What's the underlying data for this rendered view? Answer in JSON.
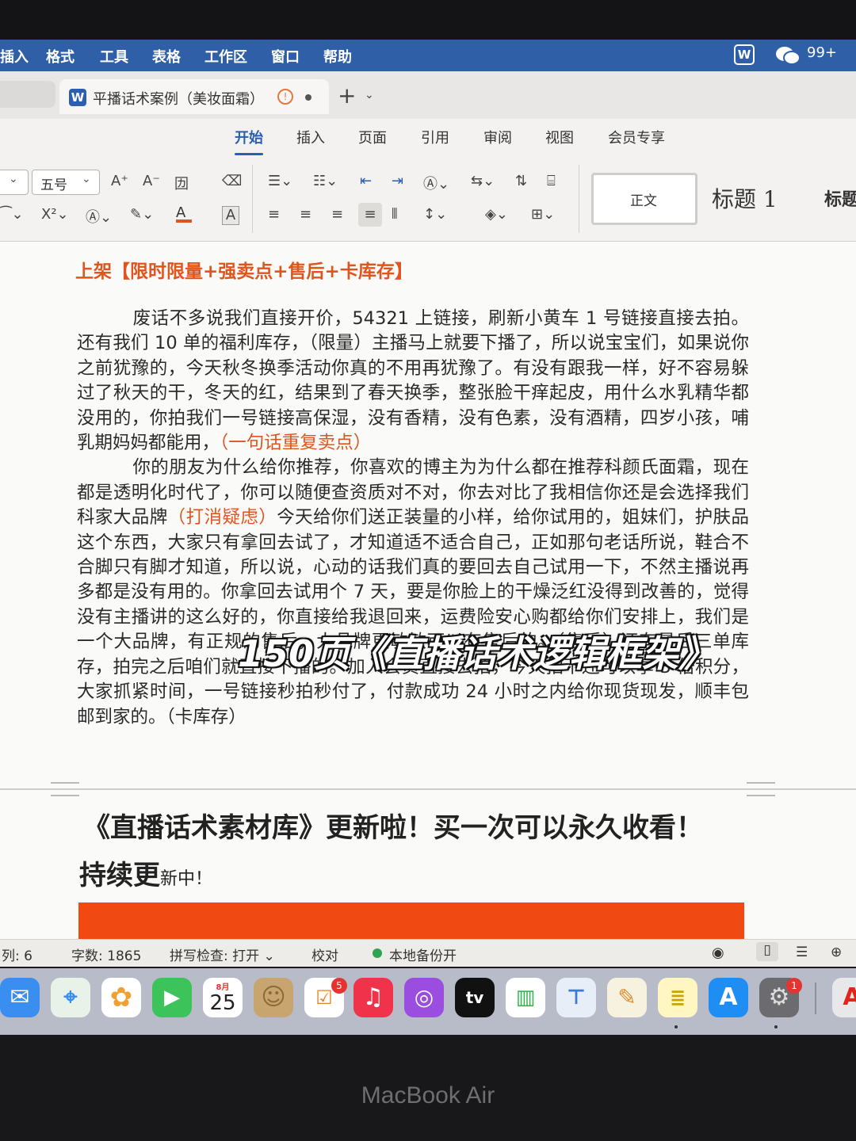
{
  "menubar": {
    "items": [
      "插入",
      "格式",
      "工具",
      "表格",
      "工作区",
      "窗口",
      "帮助"
    ],
    "wechat_badge": "99+"
  },
  "tabbar": {
    "doc_tab_title": "平播话术案例（美妆面霜）"
  },
  "ribbon": {
    "tabs": [
      "开始",
      "插入",
      "页面",
      "引用",
      "审阅",
      "视图",
      "会员专享"
    ],
    "active_tab": "开始"
  },
  "toolbar": {
    "font_size": "五号",
    "style_normal": "正文",
    "style_h1": "标题 1",
    "style_h2": "标题"
  },
  "document": {
    "heading": "上架【限时限量+强卖点+售后+卡库存】",
    "p1_a": "废话不多说我们直接开价，54321 上链接，刷新小黄车 1 号链接直接去拍。还有我们 10 单的福利库存，（限量）主播马上就要下播了，所以说宝宝们，如果说你之前犹豫的，今天秋冬换季活动你真的不用再犹豫了。有没有跟我一样，好不容易躲过了秋天的干，冬天的红，结果到了春天换季，整张脸干痒起皮，用什么水乳精华都没用的，你拍我们一号链接高保湿，没有香精，没有色素，没有酒精，四岁小孩，哺乳期妈妈都能用，",
    "p1_hl": "（一句话重复卖点）",
    "p2_a": "你的朋友为什么给你推荐，你喜欢的博主为为什么都在推荐科颜氏面霜，现在都是透明化时代了，你可以随便查资质对不对，你去对比了我相信你还是会选择我们科家大品牌",
    "p2_hl": "（打消疑虑）",
    "p2_b": "今天给你们送正装量的小样，给你试用的，姐妹们，护肤品这个东西，大家只有拿回去试了，才知道适不适合自己，正如那句老话所说，鞋合不合脚只有脚才知道，所以说，心动的话我们真的要回去自己试用一下，不然主播说再多都是没有用的。你拿回去试用个 7 天，要是你脸上的干燥泛红没得到改善的，觉得没有主播讲的这么好的，你直接给我退回来，运费险安心购都给你们安排上，我们是一个大品牌，有正规的售后，大品牌更敏敏可以有售后的。（售后）还有最后三单库存，拍完之后咱们就直接下播的。加入会员直接去拍，今天拍下还可以享 3 倍积分，大家抓紧时间，一号链接秒拍秒付了，付款成功 24 小时之内给你现货现发，顺丰包邮到家的。（卡库存）",
    "overlay_title": "150页《直播话术逻辑框架》",
    "library_title": "《直播话术素材库》更新啦！买一次可以永久收看！",
    "update_big": "持续更",
    "update_small": "新中！"
  },
  "statusbar": {
    "col": "列: 6",
    "word_count": "字数: 1865",
    "spellcheck": "拼写检查: 打开",
    "proofread": "校对",
    "backup": "本地备份开"
  },
  "dock": {
    "calendar_month": "8月",
    "calendar_day": "25",
    "reminders_badge": "5",
    "settings_badge": "1",
    "tv_label": "tv"
  },
  "bezel": {
    "label": "MacBook Air"
  },
  "colors": {
    "accent": "#2b5fb0",
    "highlight": "#e0551e",
    "banner": "#f04a12"
  }
}
